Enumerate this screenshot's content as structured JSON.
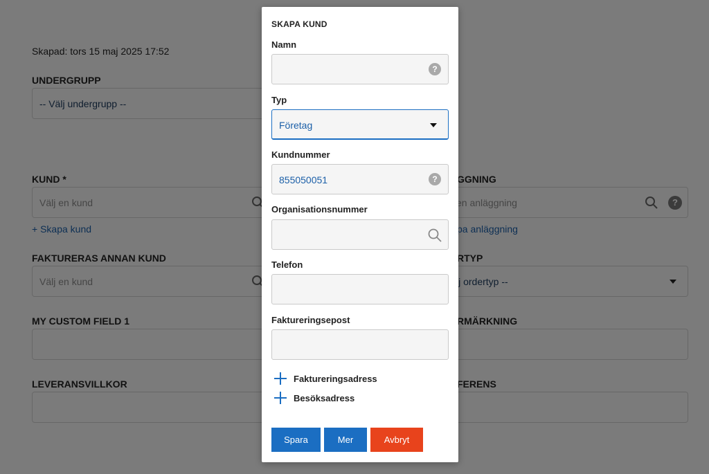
{
  "background": {
    "created": "Skapad: tors 15 maj 2025 17:52",
    "subgroup": {
      "label": "UNDERGRUPP",
      "placeholder": "-- Välj undergrupp --"
    },
    "customer": {
      "label": "KUND *",
      "placeholder": "Välj en kund",
      "link": "+ Skapa kund"
    },
    "installation": {
      "label": "GGNING",
      "placeholder": "en anläggning",
      "link": "pa anläggning"
    },
    "invoiced_other": {
      "label": "FAKTURERAS ANNAN KUND",
      "placeholder": "Välj en kund"
    },
    "ordertype": {
      "label": "RTYP",
      "placeholder": "lj ordertyp --"
    },
    "custom1": {
      "label": "MY CUSTOM FIELD 1"
    },
    "marking": {
      "label": "RMÄRKNING"
    },
    "delivery": {
      "label": "LEVERANSVILLKOR"
    },
    "reference": {
      "label": "FERENS"
    }
  },
  "modal": {
    "title": "SKAPA KUND",
    "fields": {
      "name": {
        "label": "Namn",
        "value": ""
      },
      "type": {
        "label": "Typ",
        "value": "Företag"
      },
      "customer_number": {
        "label": "Kundnummer",
        "value": "855050051"
      },
      "org_number": {
        "label": "Organisationsnummer",
        "value": ""
      },
      "phone": {
        "label": "Telefon",
        "value": ""
      },
      "invoice_email": {
        "label": "Faktureringsepost",
        "value": ""
      }
    },
    "expanders": {
      "billing_address": "Faktureringsadress",
      "visit_address": "Besöksadress"
    },
    "buttons": {
      "save": "Spara",
      "more": "Mer",
      "cancel": "Avbryt"
    },
    "help_glyph": "?"
  },
  "colors": {
    "primary": "#1b6ec2",
    "danger": "#e8431c",
    "link": "#1b5fa8"
  }
}
